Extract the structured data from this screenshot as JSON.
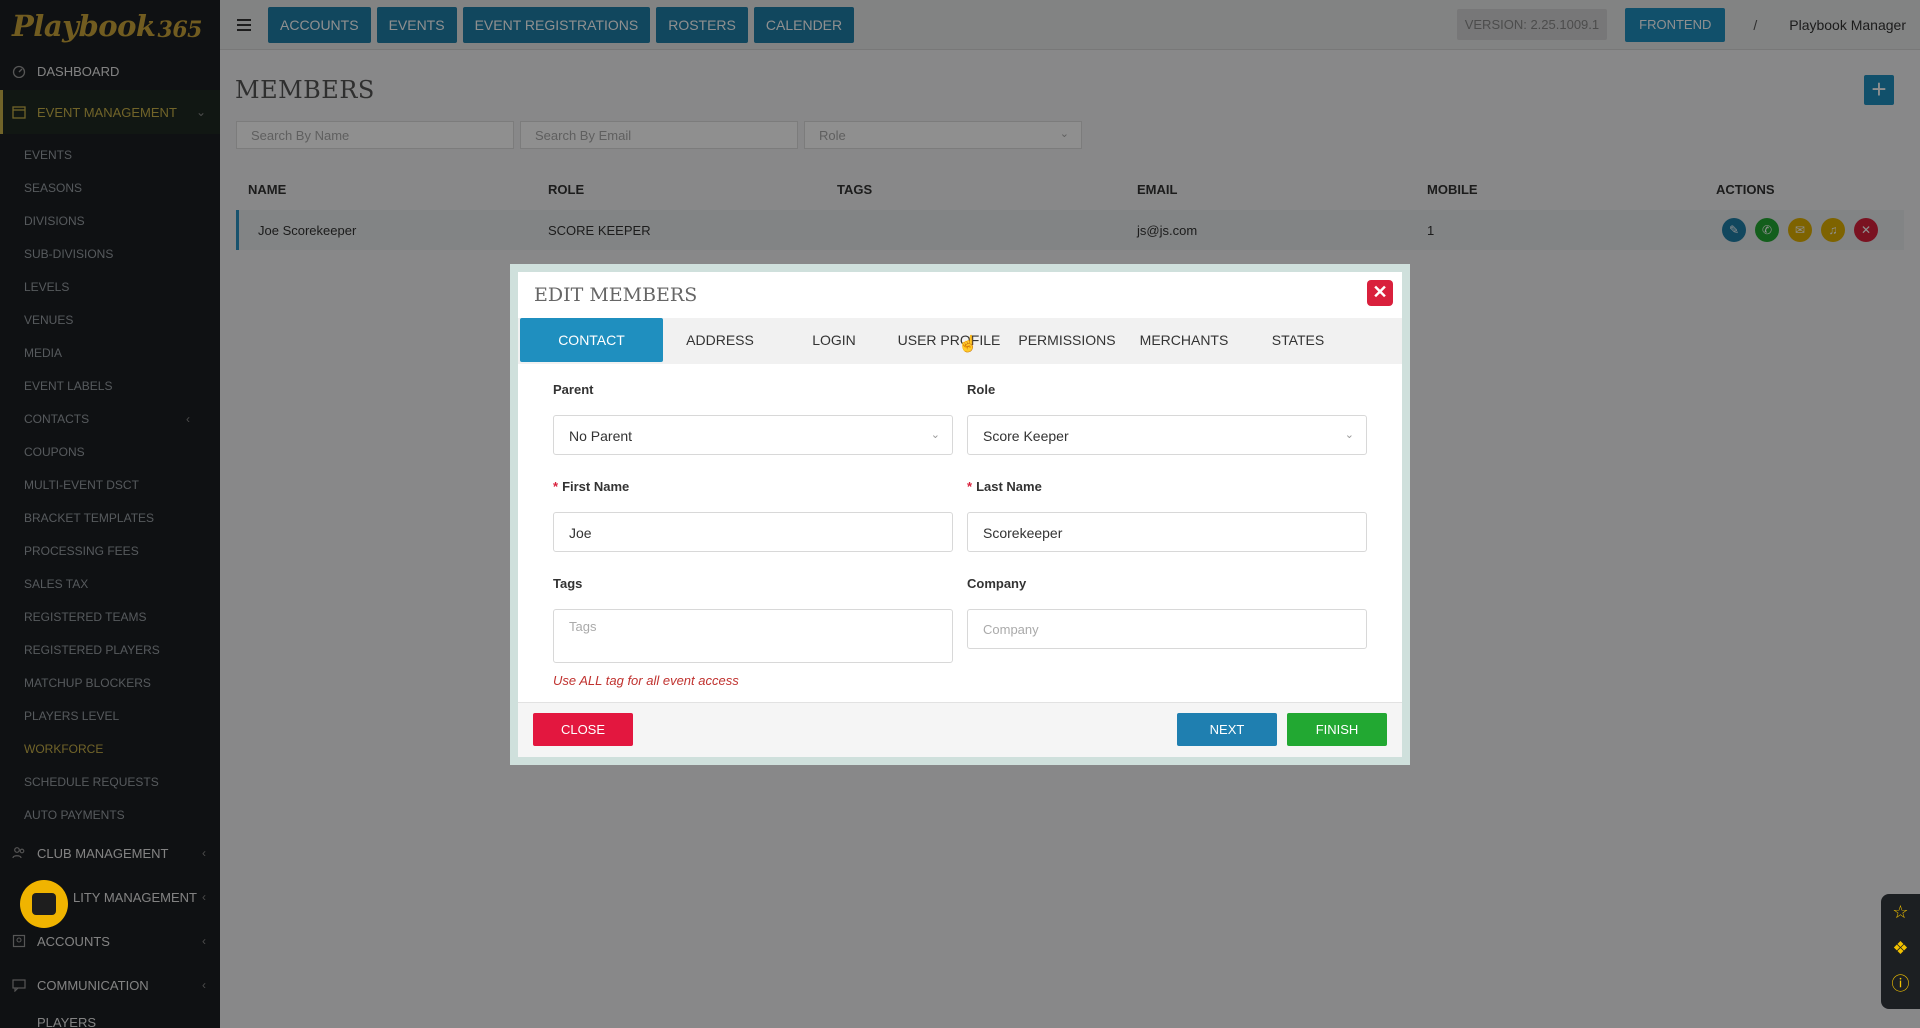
{
  "brand": {
    "name": "Playbook",
    "suffix": "365"
  },
  "sidebar": {
    "dashboard": "DASHBOARD",
    "event_management": "EVENT MANAGEMENT",
    "sub_items": [
      "EVENTS",
      "SEASONS",
      "DIVISIONS",
      "SUB-DIVISIONS",
      "LEVELS",
      "VENUES",
      "MEDIA",
      "EVENT LABELS",
      "CONTACTS",
      "COUPONS",
      "MULTI-EVENT DSCT",
      "BRACKET TEMPLATES",
      "PROCESSING FEES",
      "SALES TAX",
      "REGISTERED TEAMS",
      "REGISTERED PLAYERS",
      "MATCHUP BLOCKERS",
      "PLAYERS LEVEL",
      "WORKFORCE",
      "SCHEDULE REQUESTS",
      "AUTO PAYMENTS"
    ],
    "club_management": "CLUB MANAGEMENT",
    "facility_management": "LITY MANAGEMENT",
    "accounts": "ACCOUNTS",
    "communication": "COMMUNICATION",
    "players": "PLAYERS"
  },
  "topbar": {
    "nav": [
      "ACCOUNTS",
      "EVENTS",
      "EVENT REGISTRATIONS",
      "ROSTERS",
      "CALENDER"
    ],
    "version": "VERSION: 2.25.1009.1",
    "frontend": "FRONTEND",
    "separator": "/",
    "user": "Playbook Manager"
  },
  "page": {
    "title": "MEMBERS",
    "search_name_placeholder": "Search By Name",
    "search_email_placeholder": "Search By Email",
    "role_placeholder": "Role"
  },
  "table": {
    "headers": [
      "NAME",
      "ROLE",
      "TAGS",
      "EMAIL",
      "MOBILE",
      "ACTIONS"
    ],
    "rows": [
      {
        "name": "Joe Scorekeeper",
        "role": "SCORE KEEPER",
        "tags": "",
        "email": "js@js.com",
        "mobile": "1"
      }
    ]
  },
  "modal": {
    "title": "EDIT MEMBERS",
    "tabs": [
      "CONTACT",
      "ADDRESS",
      "LOGIN",
      "USER PROFILE",
      "PERMISSIONS",
      "MERCHANTS",
      "STATES"
    ],
    "active_tab": "CONTACT",
    "parent_label": "Parent",
    "parent_value": "No Parent",
    "role_label": "Role",
    "role_value": "Score Keeper",
    "first_name_label": "First Name",
    "first_name_value": "Joe",
    "last_name_label": "Last Name",
    "last_name_value": "Scorekeeper",
    "tags_label": "Tags",
    "tags_placeholder": "Tags",
    "company_label": "Company",
    "company_placeholder": "Company",
    "hint": "Use ALL tag for all event access",
    "close_button": "CLOSE",
    "next_button": "NEXT",
    "finish_button": "FINISH",
    "required_mark": "*"
  },
  "colors": {
    "accent": "#1f8fbf",
    "danger": "#d9203c",
    "success": "#22a832",
    "sidebar_bg": "#1c1f22",
    "highlight": "#c9b24a"
  }
}
